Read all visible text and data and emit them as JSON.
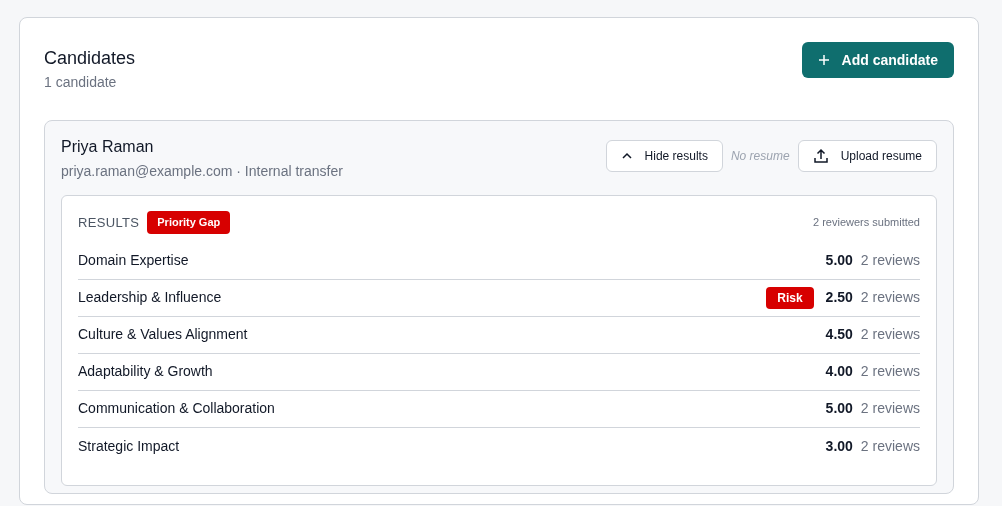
{
  "header": {
    "title": "Candidates",
    "subtitle": "1 candidate",
    "add_button": "Add candidate"
  },
  "candidate": {
    "name": "Priya Raman",
    "details": "priya.raman@example.com · Internal transfer",
    "toggle_button": "Hide results",
    "expanded": true,
    "resume_status": "No resume",
    "upload_button": "Upload resume",
    "results": {
      "label": "RESULTS",
      "badge": "Priority Gap",
      "reviewers": "2 reviewers submitted",
      "rows": [
        {
          "criterion": "Domain Expertise",
          "score": "5.00",
          "reviews": "2 reviews"
        },
        {
          "criterion": "Leadership & Influence",
          "badge": "Risk",
          "score": "2.50",
          "reviews": "2 reviews"
        },
        {
          "criterion": "Culture & Values Alignment",
          "score": "4.50",
          "reviews": "2 reviews"
        },
        {
          "criterion": "Adaptability & Growth",
          "score": "4.00",
          "reviews": "2 reviews"
        },
        {
          "criterion": "Communication & Collaboration",
          "score": "5.00",
          "reviews": "2 reviews"
        },
        {
          "criterion": "Strategic Impact",
          "score": "3.00",
          "reviews": "2 reviews"
        }
      ]
    }
  }
}
